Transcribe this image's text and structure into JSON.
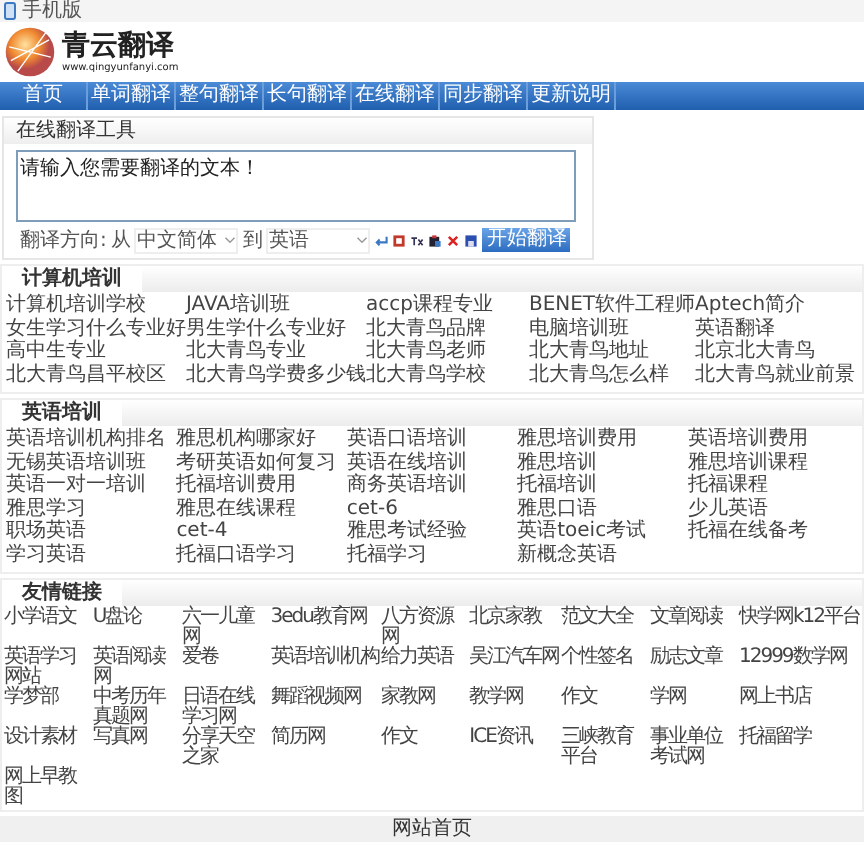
{
  "window": {
    "title": "手机版"
  },
  "logo": {
    "name": "青云翻译",
    "url": "www.qingyunfanyi.com"
  },
  "nav": [
    "首页",
    "单词翻译",
    "整句翻译",
    "长句翻译",
    "在线翻译",
    "同步翻译",
    "更新说明"
  ],
  "translator": {
    "title": "在线翻译工具",
    "placeholder": "请输入您需要翻译的文本！",
    "direction_label": "翻译方向:",
    "from_label": "从",
    "from": "中文简体",
    "to_label": "到",
    "to": "英语",
    "button": "开始翻译"
  },
  "sections": [
    {
      "title": "计算机培训",
      "links": [
        "计算机培训学校",
        "JAVA培训班",
        "accp课程专业",
        "BENET软件工程师",
        "Aptech简介",
        "女生学习什么专业好",
        "男生学什么专业好",
        "北大青鸟品牌",
        "电脑培训班",
        "英语翻译",
        "高中生专业",
        "北大青鸟专业",
        "北大青鸟老师",
        "北大青鸟地址",
        "北京北大青鸟",
        "北大青鸟昌平校区",
        "北大青鸟学费多少钱",
        "北大青鸟学校",
        "北大青鸟怎么样",
        "北大青鸟就业前景"
      ]
    },
    {
      "title": "英语培训",
      "links": [
        "英语培训机构排名",
        "雅思机构哪家好",
        "英语口语培训",
        "雅思培训费用",
        "英语培训费用",
        "无锡英语培训班",
        "考研英语如何复习",
        "英语在线培训",
        "雅思培训",
        "雅思培训课程",
        "英语一对一培训",
        "托福培训费用",
        "商务英语培训",
        "托福培训",
        "托福课程",
        "雅思学习",
        "雅思在线课程",
        "cet-6",
        "雅思口语",
        "少儿英语",
        "职场英语",
        "cet-4",
        "雅思考试经验",
        "英语toeic考试",
        "托福在线备考",
        "学习英语",
        "托福口语学习",
        "托福学习",
        "新概念英语"
      ]
    }
  ],
  "friend_links": {
    "title": "友情链接",
    "links": [
      "小学语文",
      "U盘论",
      "六一儿童网",
      "3edu教育网",
      "八方资源网",
      "北京家教",
      "范文大全",
      "文章阅读",
      "快学网k12平台",
      "英语学习网站",
      "英语阅读网",
      "爱卷",
      "英语培训机构",
      "给力英语",
      "吴江汽车网",
      "个性签名",
      "励志文章",
      "12999数学网",
      "学梦部",
      "中考历年真题网",
      "日语在线学习网",
      "舞蹈视频网",
      "家教网",
      "教学网",
      "作文",
      "学网",
      "网上书店",
      "设计素材",
      "写真网",
      "分享天空之家",
      "简历网",
      "作文",
      "ICE资讯",
      "三峡教育平台",
      "事业单位考试网",
      "托福留学",
      "网上早教图"
    ]
  },
  "footer": {
    "link": "网站首页"
  }
}
